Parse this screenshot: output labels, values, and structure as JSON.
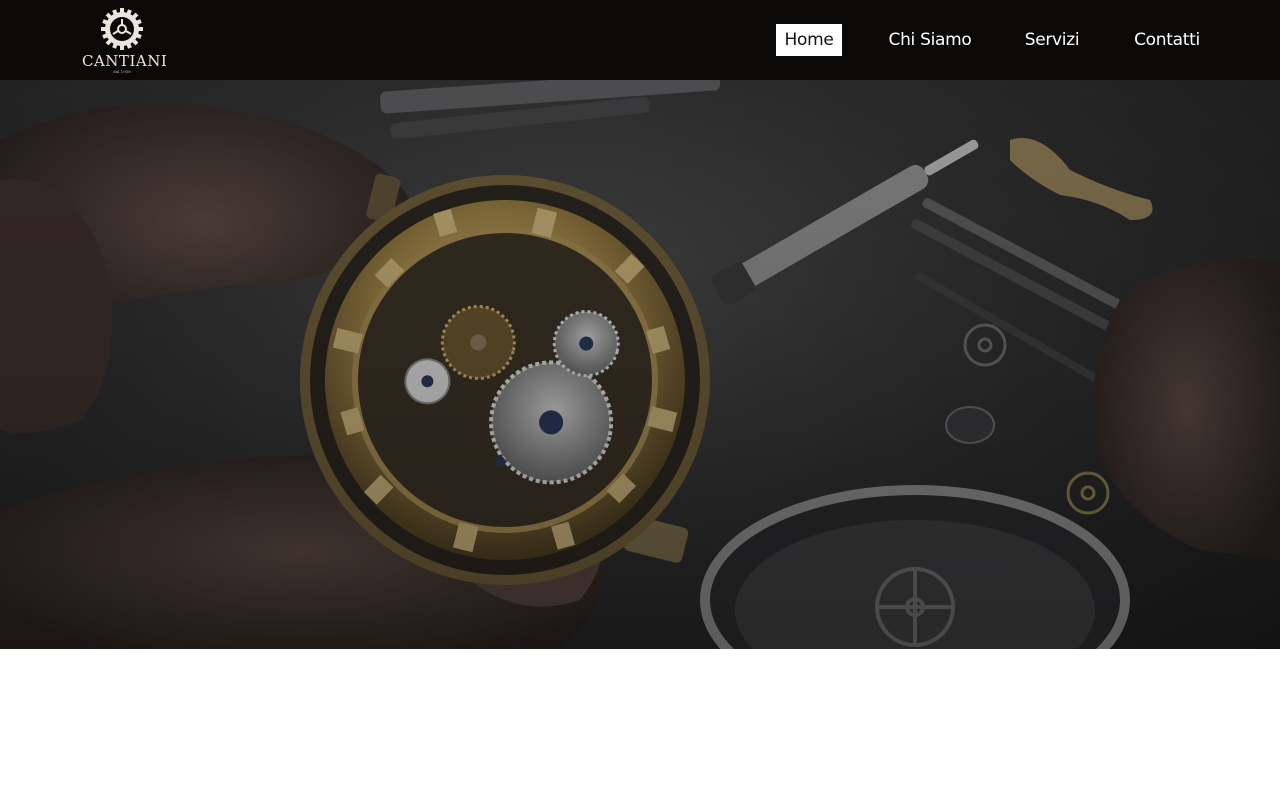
{
  "brand": {
    "name": "CANTIANI",
    "tagline": "dal 1958"
  },
  "nav": {
    "items": [
      {
        "label": "Home",
        "active": true
      },
      {
        "label": "Chi Siamo",
        "active": false
      },
      {
        "label": "Servizi",
        "active": false
      },
      {
        "label": "Contatti",
        "active": false
      }
    ]
  },
  "hero": {
    "image": "watchmaker-repairing-skeleton-watch"
  },
  "colors": {
    "header_bg": "#0a0908",
    "nav_active_bg": "#ffffff",
    "nav_text": "#ffffff",
    "gold": "#b59a55"
  }
}
